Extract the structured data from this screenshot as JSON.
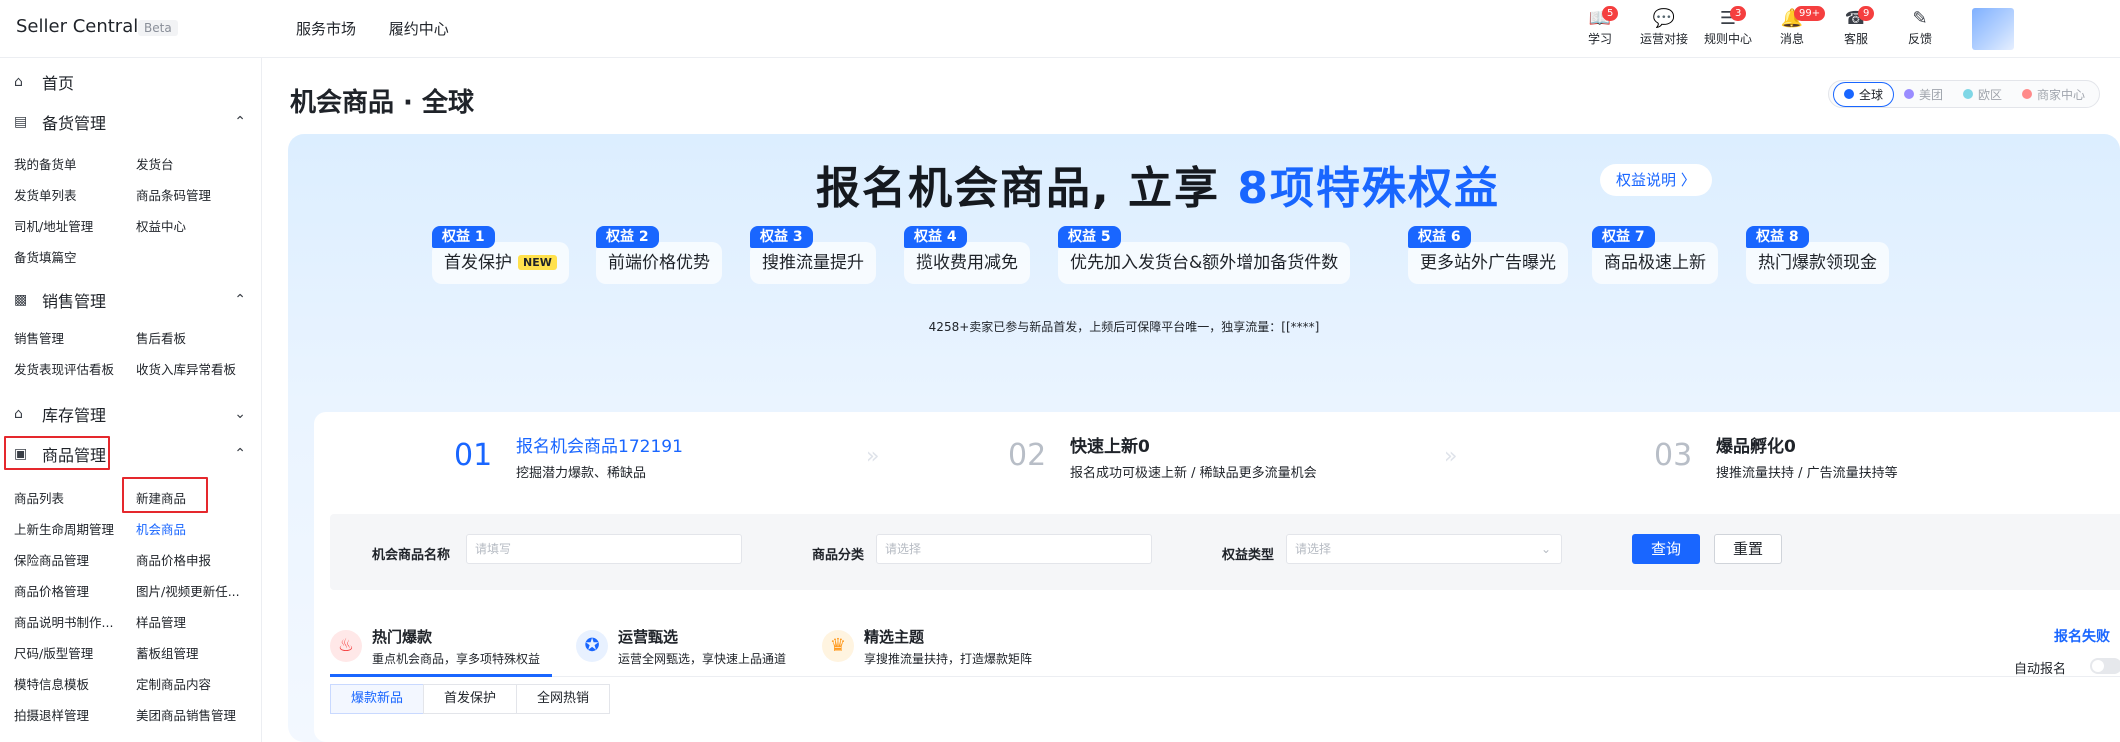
{
  "app": {
    "brand": "Seller Central",
    "beta": "Beta"
  },
  "topnav": [
    "服务市场",
    "履约中心"
  ],
  "tools": [
    {
      "label": "学习",
      "icon": "book-icon",
      "badge": "5"
    },
    {
      "label": "运营对接",
      "icon": "chat-icon",
      "badge": ""
    },
    {
      "label": "规则中心",
      "icon": "rules-icon",
      "badge": "3"
    },
    {
      "label": "消息",
      "icon": "bell-icon",
      "badge": "99+"
    },
    {
      "label": "客服",
      "icon": "service-icon",
      "badge": "9"
    },
    {
      "label": "反馈",
      "icon": "feedback-icon",
      "badge": ""
    }
  ],
  "sidebar": {
    "home": "首页",
    "sections": [
      {
        "label": "备货管理",
        "items": [
          "我的备货单",
          "发货台",
          "发货单列表",
          "商品条码管理",
          "司机/地址管理",
          "权益中心",
          "备货填篇空"
        ]
      },
      {
        "label": "销售管理",
        "items": [
          "销售管理",
          "售后看板",
          "发货表现评估看板",
          "收货入库异常看板"
        ]
      },
      {
        "label": "库存管理",
        "items": []
      },
      {
        "label": "商品管理",
        "items": [
          "商品列表",
          "新建商品",
          "上新生命周期管理",
          "机会商品",
          "保险商品管理",
          "商品价格申报",
          "商品价格管理",
          "图片/视频更新任...",
          "商品说明书制作...",
          "样品管理",
          "尺码/版型管理",
          "蓄板组管理",
          "模特信息模板",
          "定制商品内容",
          "拍摄退样管理",
          "美团商品销售管理"
        ]
      }
    ]
  },
  "page": {
    "title": "机会商品 · 全球"
  },
  "regions": [
    "全球",
    "美团",
    "欧区",
    "商家中心"
  ],
  "hero": {
    "title_a": "报名机会商品, 立享 ",
    "title_b": "8项特殊权益",
    "explain": "权益说明 〉",
    "perks": [
      {
        "tag": "权益 1",
        "text": "首发保护",
        "new": "NEW"
      },
      {
        "tag": "权益 2",
        "text": "前端价格优势"
      },
      {
        "tag": "权益 3",
        "text": "搜推流量提升"
      },
      {
        "tag": "权益 4",
        "text": "揽收费用减免"
      },
      {
        "tag": "权益 5",
        "text": "优先加入发货台&额外增加备货件数"
      },
      {
        "tag": "权益 6",
        "text": "更多站外广告曝光"
      },
      {
        "tag": "权益 7",
        "text": "商品极速上新"
      },
      {
        "tag": "权益 8",
        "text": "热门爆款领现金"
      }
    ],
    "notice": "4258+卖家已参与新品首发，上频后可保障平台唯一，独享流量：[[****]"
  },
  "steps": [
    {
      "num": "01",
      "title": "报名机会商品172191",
      "desc": "挖掘潜力爆款、稀缺品"
    },
    {
      "num": "02",
      "title": "快速上新0",
      "desc": "报名成功可极速上新 / 稀缺品更多流量机会"
    },
    {
      "num": "03",
      "title": "爆品孵化0",
      "desc": "搜推流量扶持 / 广告流量扶持等"
    }
  ],
  "filter": {
    "name_label": "机会商品名称",
    "name_placeholder": "请填写",
    "cat_label": "商品分类",
    "cat_placeholder": "请选择",
    "type_label": "权益类型",
    "type_placeholder": "请选择",
    "query": "查询",
    "reset": "重置"
  },
  "categories": [
    {
      "title": "热门爆款",
      "desc": "重点机会商品，享多项特殊权益",
      "icon": "fire-icon"
    },
    {
      "title": "运营甄选",
      "desc": "运营全网甄选，享快速上品通道",
      "icon": "medal-icon"
    },
    {
      "title": "精选主题",
      "desc": "享搜推流量扶持，打造爆款矩阵",
      "icon": "crown-icon"
    }
  ],
  "sign_fail": "报名失败",
  "auto_sign": "自动报名",
  "subtabs": [
    "爆款新品",
    "首发保护",
    "全网热销"
  ],
  "colors": {
    "accent": "#1966ff",
    "badge": "#f53f3f",
    "highlight_box": "#e5282d"
  }
}
